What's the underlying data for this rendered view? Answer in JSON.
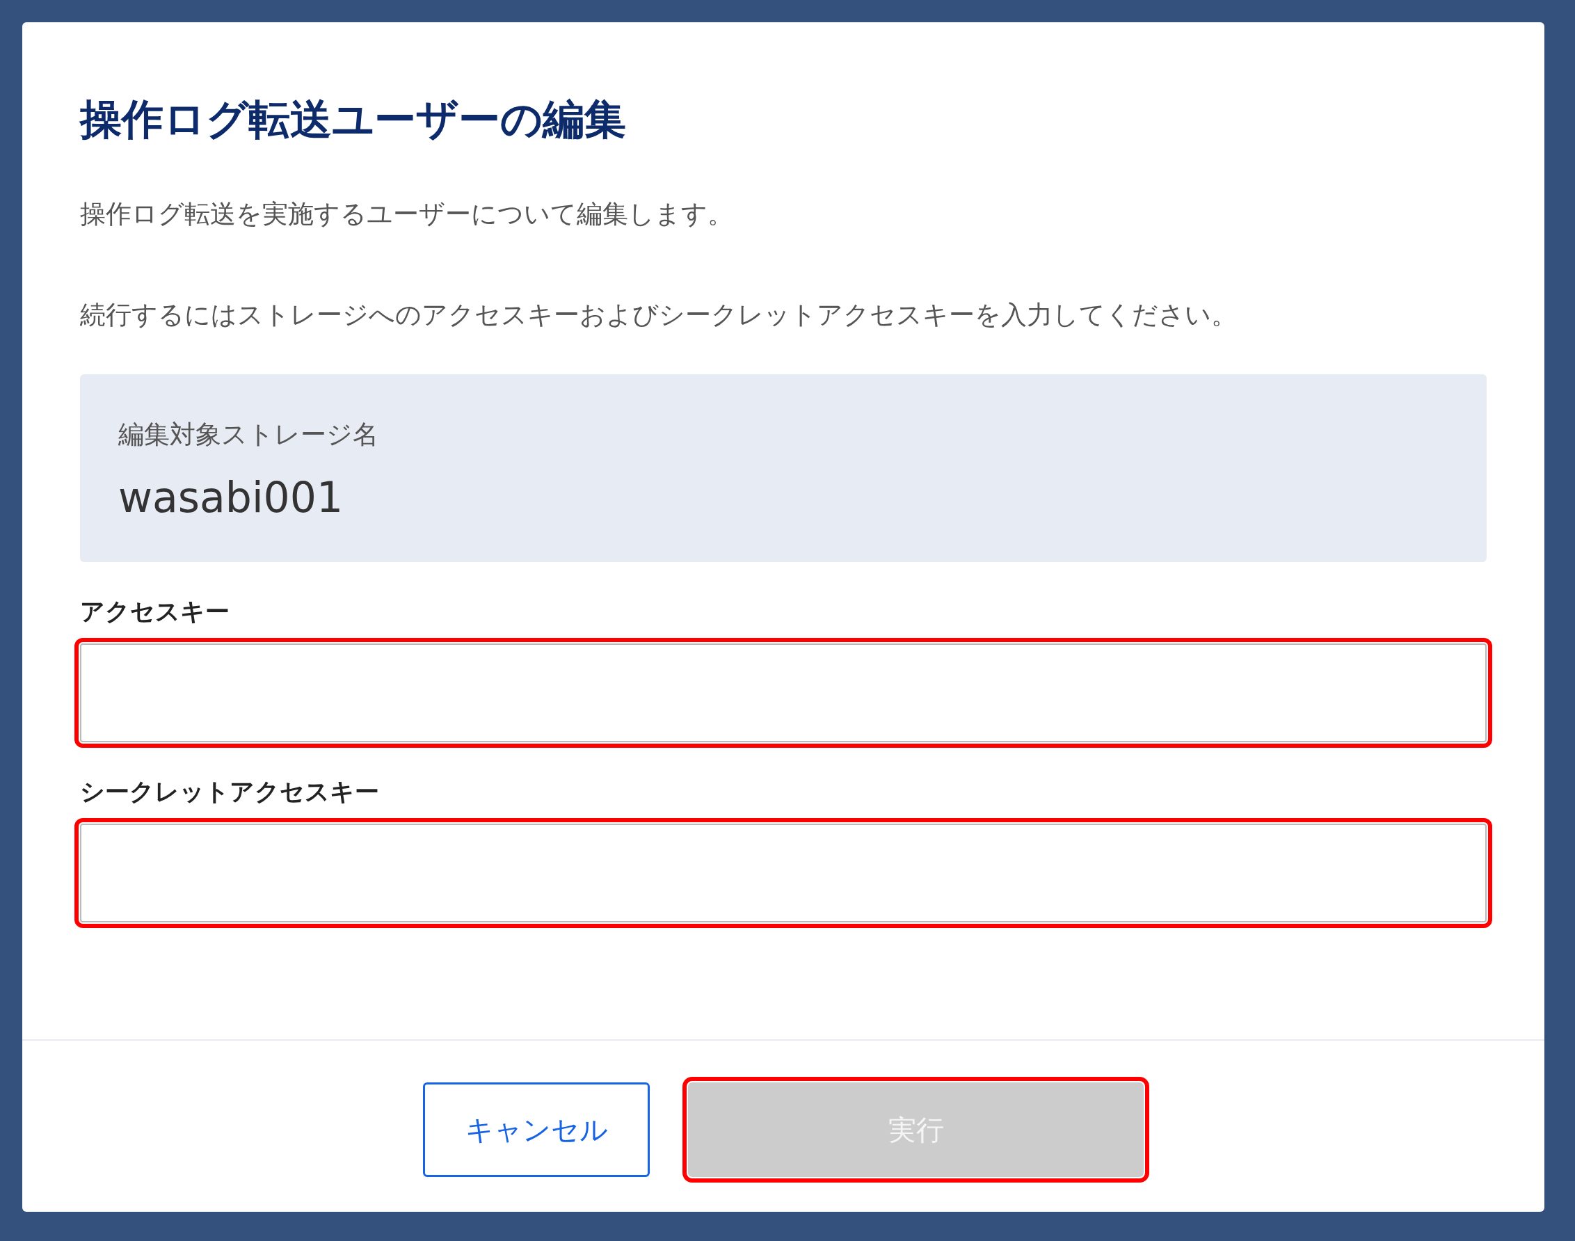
{
  "dialog": {
    "title": "操作ログ転送ユーザーの編集",
    "paragraphs": [
      "操作ログ転送を実施するユーザーについて編集します。",
      "続行するにはストレージへのアクセスキーおよびシークレットアクセスキーを入力してください。"
    ],
    "target": {
      "label": "編集対象ストレージ名",
      "value": "wasabi001"
    },
    "fields": [
      {
        "label": "アクセスキー",
        "highlighted": true
      },
      {
        "label": "シークレットアクセスキー",
        "highlighted": true
      }
    ],
    "buttons": [
      {
        "label": "キャンセル",
        "kind": "secondary",
        "disabled": false,
        "highlighted": false
      },
      {
        "label": "実行",
        "kind": "primary",
        "disabled": true,
        "highlighted": true
      }
    ]
  }
}
